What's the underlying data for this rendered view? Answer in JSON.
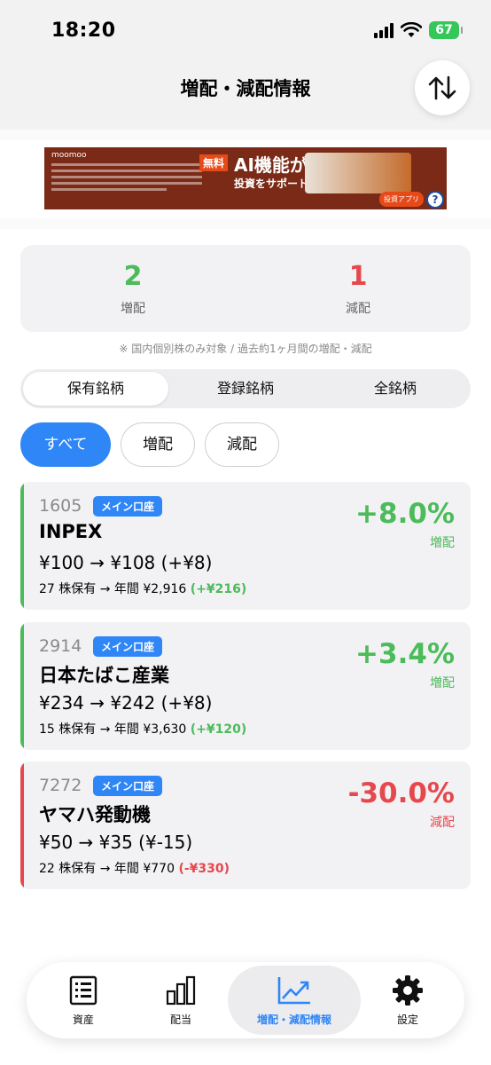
{
  "status": {
    "time": "18:20",
    "battery": "67"
  },
  "nav": {
    "title": "増配・減配情報",
    "sort_icon": "sort-arrows-icon"
  },
  "ad": {
    "brand": "moomoo",
    "tag": "無料",
    "headline": "AI機能が",
    "sub": "投資をサポート",
    "cta": "投資アプリ",
    "help": "?"
  },
  "summary": {
    "increase": {
      "count": "2",
      "label": "増配",
      "color": "#4cbb5a"
    },
    "decrease": {
      "count": "1",
      "label": "減配",
      "color": "#e5484d"
    },
    "note": "※ 国内個別株のみ対象 / 過去約1ヶ月間の増配・減配"
  },
  "scope_tabs": [
    {
      "label": "保有銘柄",
      "active": true
    },
    {
      "label": "登録銘柄",
      "active": false
    },
    {
      "label": "全銘柄",
      "active": false
    }
  ],
  "filters": [
    {
      "label": "すべて",
      "active": true
    },
    {
      "label": "増配",
      "active": false
    },
    {
      "label": "減配",
      "active": false
    }
  ],
  "stocks": [
    {
      "code": "1605",
      "account": "メイン口座",
      "name": "INPEX",
      "price": "¥100 → ¥108 (+¥8)",
      "holding": "27 株保有 → 年間 ¥2,916",
      "diff": "(+¥216)",
      "pct": "+8.0%",
      "kind": "増配",
      "color": "#4cbb5a"
    },
    {
      "code": "2914",
      "account": "メイン口座",
      "name": "日本たばこ産業",
      "price": "¥234 → ¥242 (+¥8)",
      "holding": "15 株保有 → 年間 ¥3,630",
      "diff": "(+¥120)",
      "pct": "+3.4%",
      "kind": "増配",
      "color": "#4cbb5a"
    },
    {
      "code": "7272",
      "account": "メイン口座",
      "name": "ヤマハ発動機",
      "price": "¥50 → ¥35 (¥-15)",
      "holding": "22 株保有 → 年間 ¥770",
      "diff": "(-¥330)",
      "pct": "-30.0%",
      "kind": "減配",
      "color": "#e5484d"
    }
  ],
  "tabbar": [
    {
      "label": "資産",
      "icon": "list-icon",
      "active": false
    },
    {
      "label": "配当",
      "icon": "bar-chart-icon",
      "active": false
    },
    {
      "label": "増配・減配情報",
      "icon": "trend-up-icon",
      "active": true
    },
    {
      "label": "設定",
      "icon": "gear-icon",
      "active": false
    }
  ],
  "accent_color": "#2f86f6"
}
